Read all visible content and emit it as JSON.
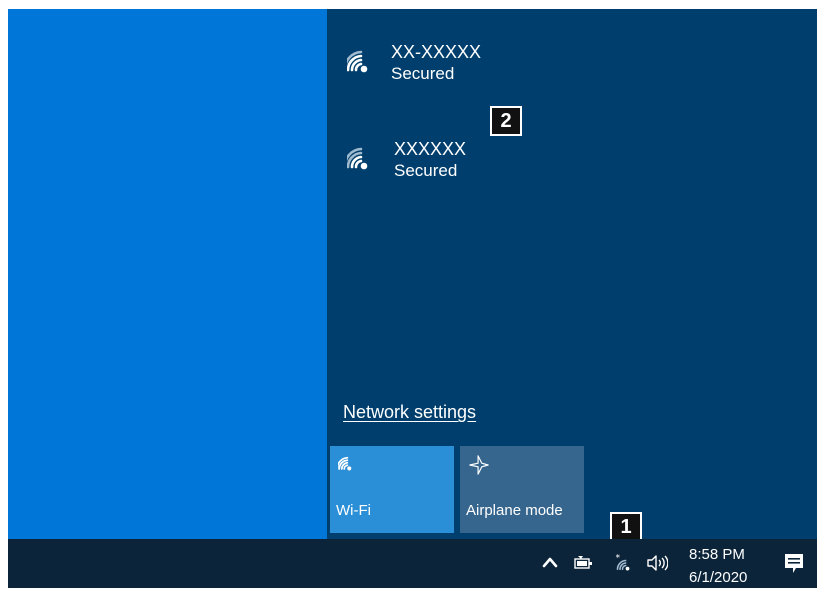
{
  "networks": [
    {
      "name": "XX-XXXXX",
      "status": "Secured"
    },
    {
      "name": "XXXXXX",
      "status": "Secured"
    }
  ],
  "callouts": {
    "one": "1",
    "two": "2"
  },
  "network_settings": "Network settings",
  "tiles": {
    "wifi": "Wi-Fi",
    "airplane": "Airplane mode"
  },
  "clock": {
    "time": "8:58 PM",
    "date": "6/1/2020"
  },
  "icons": {
    "wifi": "wifi-icon",
    "airplane": "airplane-icon",
    "chevron": "chevron-up-icon",
    "battery": "battery-icon",
    "network": "network-wifi-icon",
    "volume": "volume-icon",
    "notifications": "action-center-icon"
  },
  "colors": {
    "desktop": "#0077d8",
    "flyout": "#003f6d",
    "taskbar": "#0b2439",
    "tile_active": "#2a8fd6",
    "tile_inactive": "#36658e"
  }
}
